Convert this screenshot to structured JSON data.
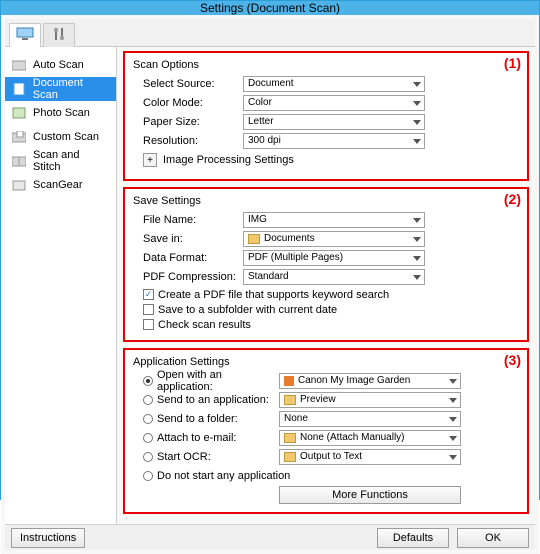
{
  "window": {
    "title": "Settings (Document Scan)"
  },
  "sidebar": {
    "items": [
      {
        "label": "Auto Scan"
      },
      {
        "label": "Document Scan"
      },
      {
        "label": "Photo Scan"
      },
      {
        "label": "Custom Scan"
      },
      {
        "label": "Scan and Stitch"
      },
      {
        "label": "ScanGear"
      }
    ],
    "selectedIndex": 1
  },
  "annotations": [
    "(1)",
    "(2)",
    "(3)"
  ],
  "scanOptions": {
    "title": "Scan Options",
    "selectSourceLabel": "Select Source:",
    "selectSourceValue": "Document",
    "colorModeLabel": "Color Mode:",
    "colorModeValue": "Color",
    "paperSizeLabel": "Paper Size:",
    "paperSizeValue": "Letter",
    "resolutionLabel": "Resolution:",
    "resolutionValue": "300 dpi",
    "ipsToggle": "Image Processing Settings"
  },
  "saveSettings": {
    "title": "Save Settings",
    "fileNameLabel": "File Name:",
    "fileNameValue": "IMG",
    "saveInLabel": "Save in:",
    "saveInValue": "Documents",
    "dataFormatLabel": "Data Format:",
    "dataFormatValue": "PDF (Multiple Pages)",
    "pdfCompressionLabel": "PDF Compression:",
    "pdfCompressionValue": "Standard",
    "chkKeywordPdf": {
      "checked": true,
      "label": "Create a PDF file that supports keyword search"
    },
    "chkSubfolder": {
      "checked": false,
      "label": "Save to a subfolder with current date"
    },
    "chkCheckResults": {
      "checked": false,
      "label": "Check scan results"
    }
  },
  "appSettings": {
    "title": "Application Settings",
    "radios": [
      {
        "label": "Open with an application:",
        "value": "Canon My Image Garden",
        "selected": true,
        "icon": "app"
      },
      {
        "label": "Send to an application:",
        "value": "Preview",
        "selected": false,
        "icon": "folder"
      },
      {
        "label": "Send to a folder:",
        "value": "None",
        "selected": false,
        "icon": null
      },
      {
        "label": "Attach to e-mail:",
        "value": "None (Attach Manually)",
        "selected": false,
        "icon": "folder"
      },
      {
        "label": "Start OCR:",
        "value": "Output to Text",
        "selected": false,
        "icon": "folder"
      }
    ],
    "radioNone": "Do not start any application",
    "moreFunctions": "More Functions"
  },
  "footer": {
    "instructions": "Instructions",
    "defaults": "Defaults",
    "ok": "OK"
  }
}
